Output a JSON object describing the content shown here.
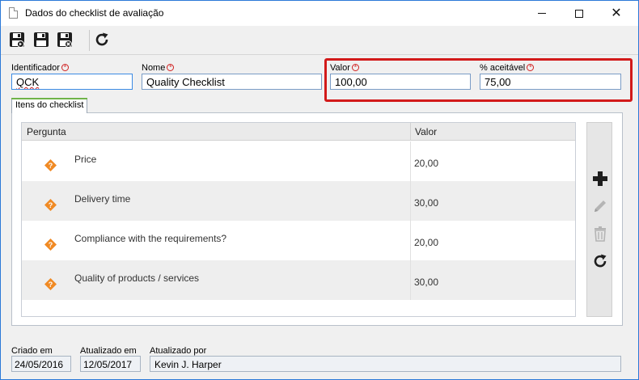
{
  "window": {
    "title": "Dados do checklist de avaliação"
  },
  "toolbar": {
    "buttons": [
      {
        "name": "save-icon"
      },
      {
        "name": "save-and-new-icon"
      },
      {
        "name": "save-and-close-icon"
      },
      {
        "name": "refresh-icon"
      }
    ]
  },
  "form": {
    "identifier": {
      "label": "Identificador",
      "value": "QCK"
    },
    "name": {
      "label": "Nome",
      "value": "Quality Checklist"
    },
    "value": {
      "label": "Valor",
      "value": "100,00"
    },
    "acceptable": {
      "label": "% aceitável",
      "value": "75,00"
    },
    "required_marker": "*"
  },
  "tabs": [
    {
      "label": "Itens do checklist",
      "active": true
    }
  ],
  "grid": {
    "columns": [
      "Pergunta",
      "Valor"
    ],
    "rows": [
      {
        "question": "Price",
        "value": "20,00"
      },
      {
        "question": "Delivery time",
        "value": "30,00"
      },
      {
        "question": "Compliance with the requirements?",
        "value": "20,00"
      },
      {
        "question": "Quality of products / services",
        "value": "30,00"
      }
    ]
  },
  "side_tools": [
    "add-icon",
    "edit-icon",
    "delete-icon",
    "refresh-icon"
  ],
  "footer": {
    "created_label": "Criado em",
    "created_value": "24/05/2016",
    "updated_label": "Atualizado em",
    "updated_value": "12/05/2017",
    "updated_by_label": "Atualizado por",
    "updated_by_value": "Kevin J. Harper"
  },
  "colors": {
    "accent_blue": "#3c8be4",
    "highlight_red": "#d21a1a",
    "question_icon_orange": "#f08a24",
    "tab_green": "#6fb34a"
  }
}
